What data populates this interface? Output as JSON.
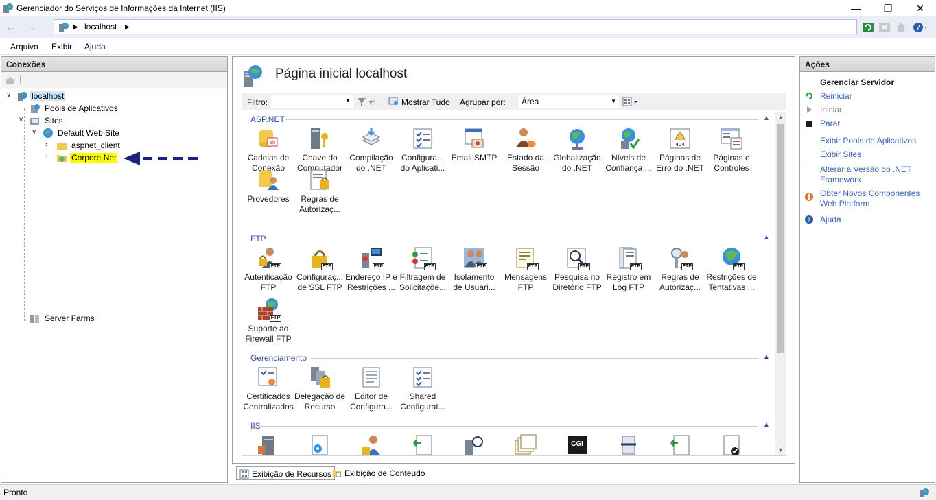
{
  "window": {
    "title": "Gerenciador do Serviços de Informações da Internet (IIS)"
  },
  "address": {
    "crumbs": [
      "localhost"
    ]
  },
  "menu": [
    "Arquivo",
    "Exibir",
    "Ajuda"
  ],
  "connections": {
    "header": "Conexões",
    "tree": {
      "localhost": "localhost",
      "pools": "Pools de Aplicativos",
      "sites": "Sites",
      "default_site": "Default Web Site",
      "aspnet_client": "aspnet_client",
      "corpore": "Corpore.Net",
      "server_farms": "Server Farms"
    }
  },
  "center": {
    "title": "Página inicial localhost",
    "filter": {
      "label": "Filtro:",
      "go": "Ir",
      "show_all": "Mostrar Tudo",
      "group_label": "Agrupar por:",
      "group_value": "Área"
    },
    "sections": [
      {
        "name": "ASP.NET",
        "items": [
          "Cadeias de\nConexão",
          "Chave do\nComputador",
          "Compilação\ndo .NET",
          "Configura...\ndo Aplicati...",
          "Email SMTP",
          "Estado da\nSessão",
          "Globalização\ndo .NET",
          "Níveis de\nConfiança ...",
          "Páginas de\nErro do .NET",
          "Páginas e\nControles",
          "Provedores",
          "Regras de\nAutorizaç..."
        ]
      },
      {
        "name": "FTP",
        "items": [
          "Autenticação\nFTP",
          "Configuraç...\nde SSL FTP",
          "Endereço IP e\nRestrições ...",
          "Filtragem de\nSolicitaçõe...",
          "Isolamento\nde Usuári...",
          "Mensagens\nFTP",
          "Pesquisa no\nDiretório FTP",
          "Registro em\nLog FTP",
          "Regras de\nAutorizaç...",
          "Restrições de\nTentativas ...",
          "Suporte ao\nFirewall FTP"
        ]
      },
      {
        "name": "Gerenciamento",
        "items": [
          "Certificados\nCentralizados",
          "Delegação de\nRecurso",
          "Editor de\nConfigura...",
          "Shared\nConfigurat..."
        ]
      },
      {
        "name": "IIS",
        "items": [
          "",
          "",
          "",
          "",
          "",
          "",
          "CGI",
          "",
          "",
          ""
        ]
      }
    ],
    "ftp_badge": "FTP",
    "cgi_label": "CGI"
  },
  "view_tabs": [
    "Exibição de Recursos",
    "Exibição de Conteúdo"
  ],
  "actions": {
    "header": "Ações",
    "manage_server": "Gerenciar Servidor",
    "restart": "Reiniciar",
    "start": "Iniciar",
    "stop": "Parar",
    "view_pools": "Exibir Pools de Aplicativos",
    "view_sites": "Exibir Sites",
    "change_net": "Alterar a Versão do .NET\nFramework",
    "get_components": "Obter Novos Componentes\nWeb Platform",
    "help": "Ajuda"
  },
  "status": {
    "text": "Pronto"
  },
  "colors": {
    "accent_link": "#3b64b7",
    "highlight": "#ffff00",
    "arrow": "#1a237e",
    "section": "#2f4f9f"
  }
}
